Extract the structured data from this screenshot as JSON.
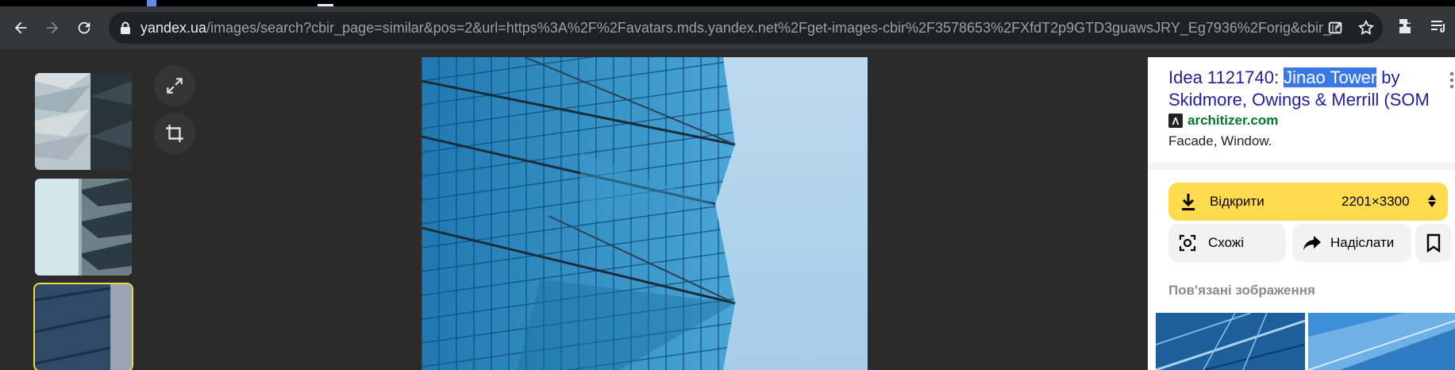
{
  "browser": {
    "url_host": "yandex.ua",
    "url_rest": "/images/search?cbir_page=similar&pos=2&url=https%3A%2F%2Favatars.mds.yandex.net%2Fget-images-cbir%2F3578653%2FXfdT2p9GTD3guawsJRY_Eg7936%2Forig&cbir_id=214..."
  },
  "panel": {
    "title_pre": "Idea 1121740: ",
    "title_highlight": "Jinao Tower",
    "title_post": " by Skidmore, Owings & Merrill (SOM",
    "source_domain": "architizer.com",
    "source_icon_glyph": "Λ",
    "description": "Facade, Window.",
    "open_label": "Відкрити",
    "size_label": "2201×3300",
    "similar_label": "Схожі",
    "share_label": "Надіслати",
    "related_heading": "Пов'язані зображення"
  },
  "colors": {
    "accent_yellow": "#ffdb4d",
    "link_blue": "#1f1fa0",
    "source_green": "#007a2e",
    "selection_blue": "#3b78e7"
  }
}
